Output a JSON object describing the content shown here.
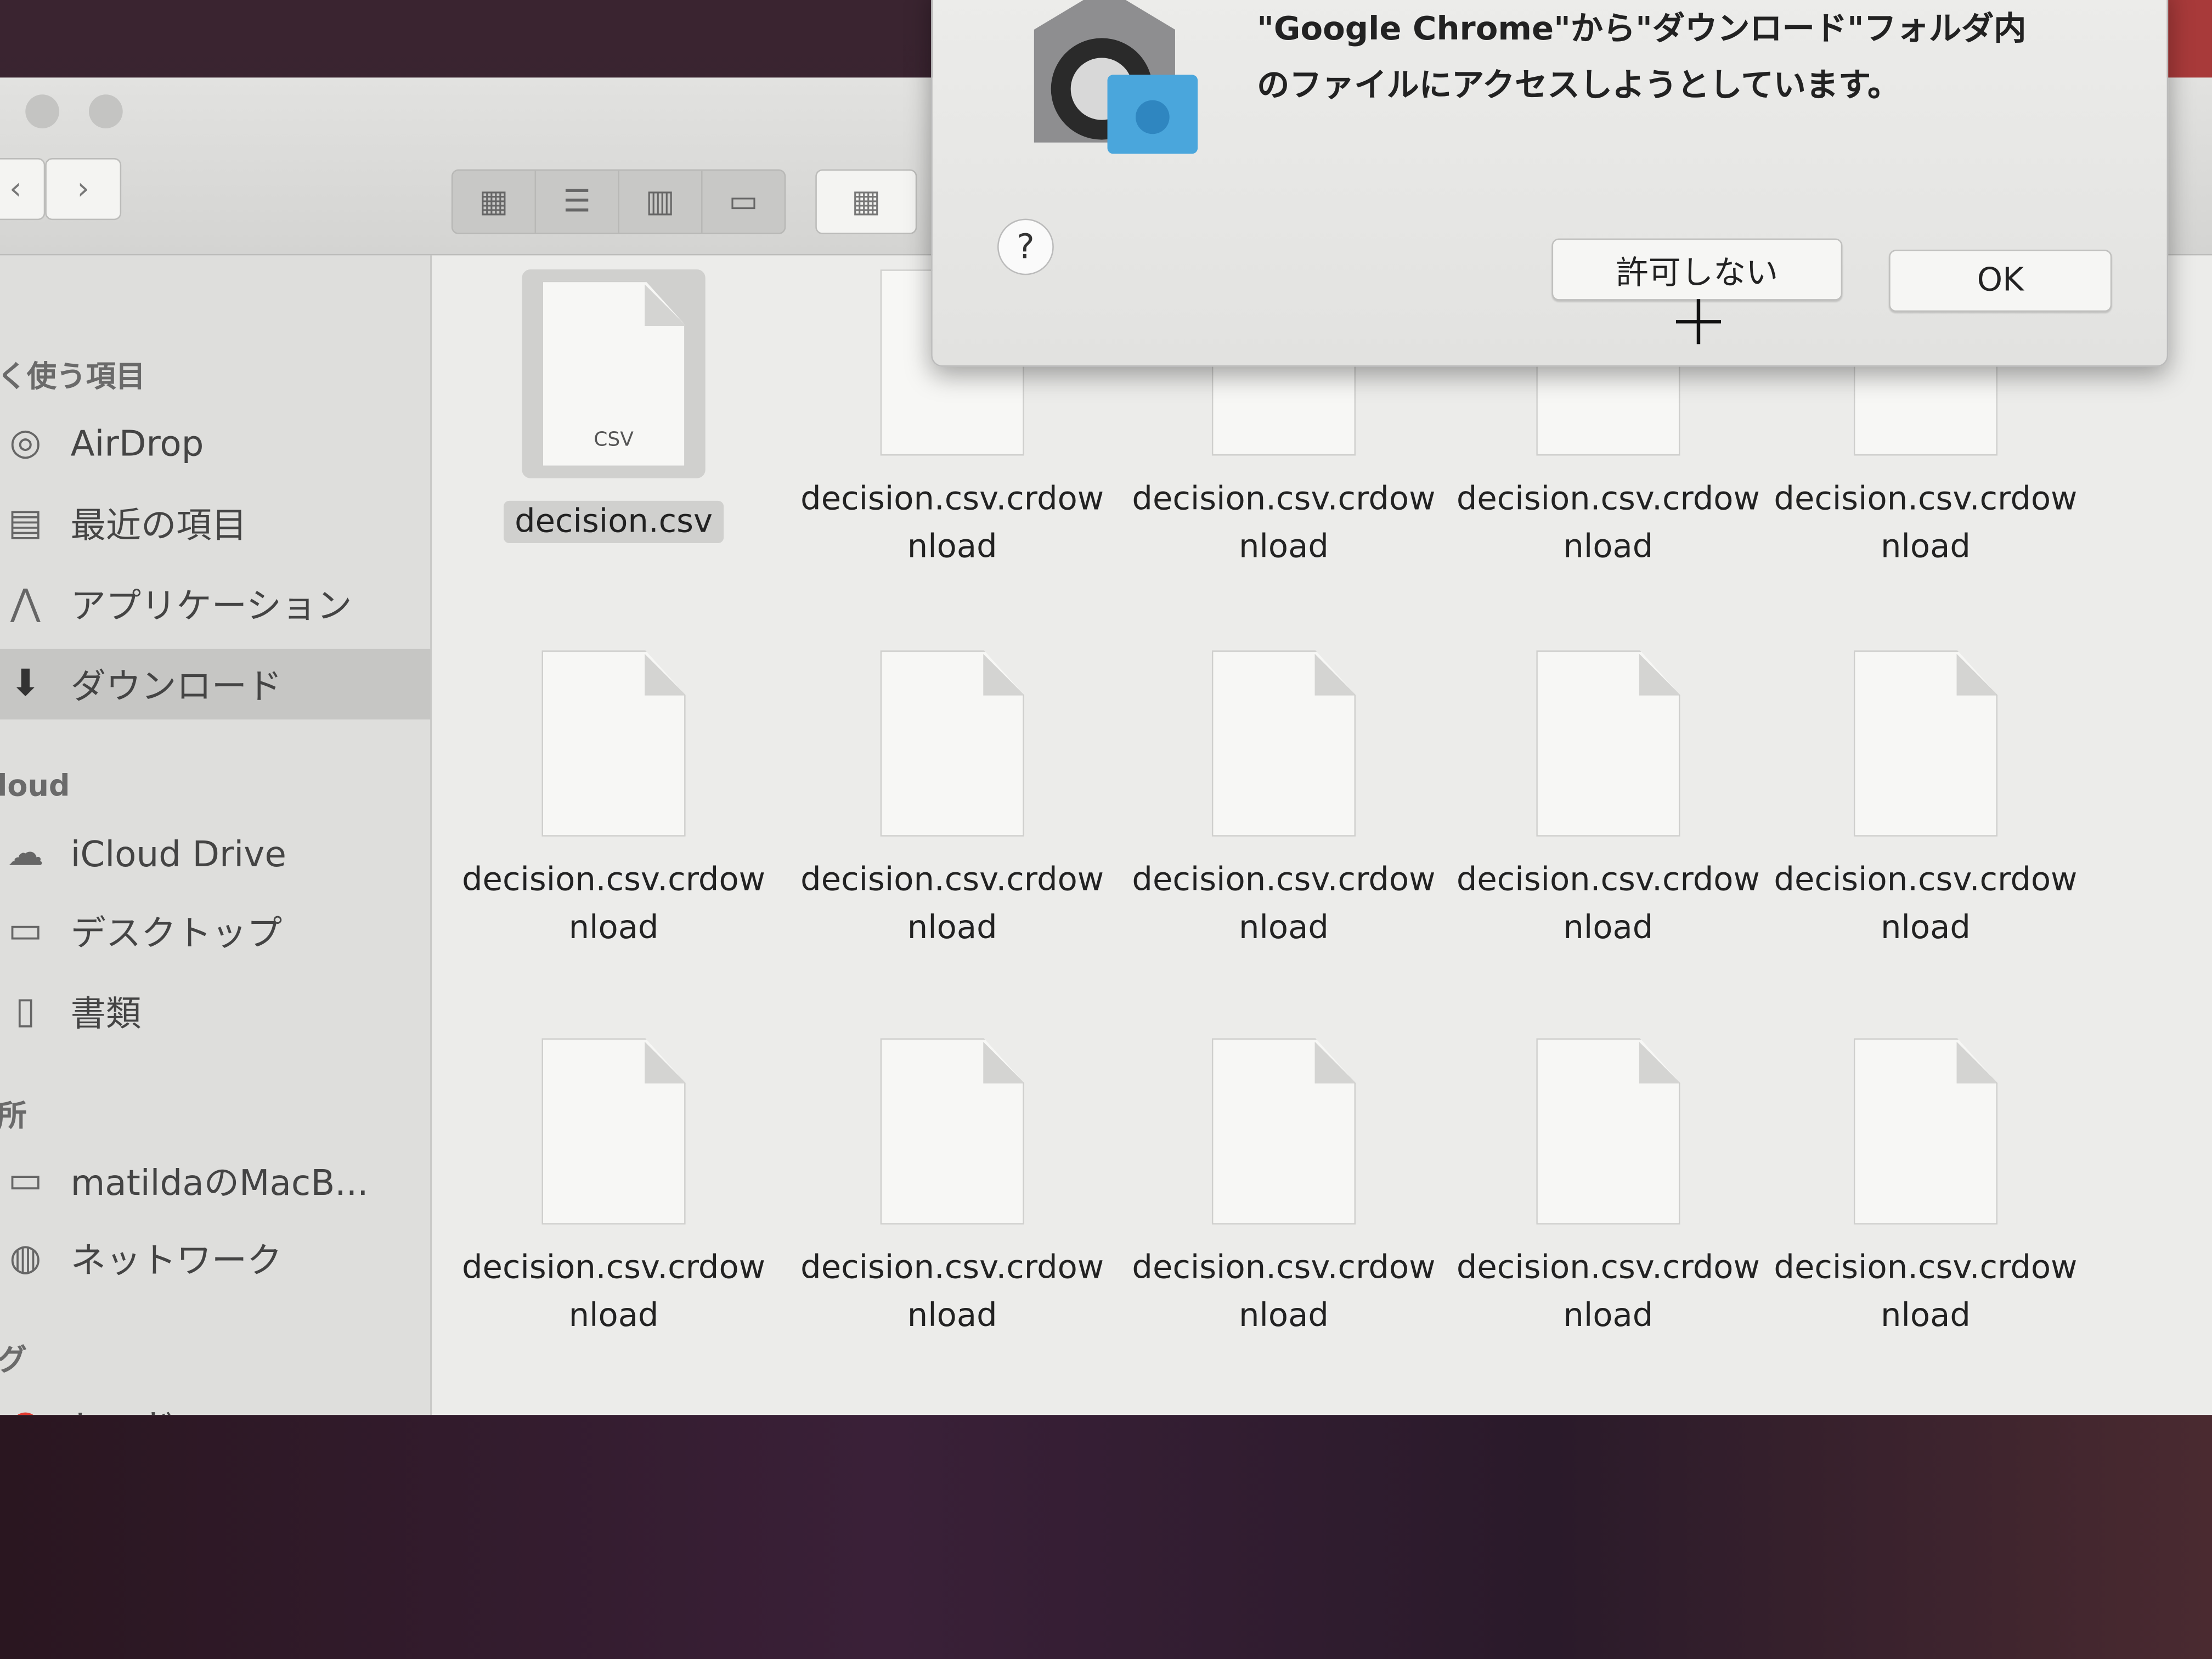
{
  "sidebar": {
    "sections": [
      {
        "header": "く使う項目",
        "items": [
          {
            "label": "AirDrop",
            "icon": "airdrop-icon"
          },
          {
            "label": "最近の項目",
            "icon": "recents-icon"
          },
          {
            "label": "アプリケーション",
            "icon": "applications-icon"
          },
          {
            "label": "ダウンロード",
            "icon": "downloads-icon",
            "selected": true
          }
        ]
      },
      {
        "header": "loud",
        "items": [
          {
            "label": "iCloud Drive",
            "icon": "cloud-icon"
          },
          {
            "label": "デスクトップ",
            "icon": "desktop-icon"
          },
          {
            "label": "書類",
            "icon": "documents-icon"
          }
        ]
      },
      {
        "header": "所",
        "items": [
          {
            "label": "matildaのMacB...",
            "icon": "laptop-icon"
          },
          {
            "label": "ネットワーク",
            "icon": "network-icon"
          }
        ]
      },
      {
        "header": "グ",
        "items": [
          {
            "label": "レッド",
            "icon": "tag-red-icon",
            "color": "#e03a30"
          }
        ]
      }
    ]
  },
  "files": [
    {
      "name": "decision.csv",
      "ext": "CSV",
      "selected": true
    },
    {
      "name": "decision.csv.crdownload"
    },
    {
      "name": "decision.csv.crdownload"
    },
    {
      "name": "decision.csv.crdownload"
    },
    {
      "name": "decision.csv.crdownload"
    },
    {
      "name": "decision.csv.crdownload"
    },
    {
      "name": "decision.csv.crdownload"
    },
    {
      "name": "decision.csv.crdownload"
    },
    {
      "name": "decision.csv.crdownload"
    },
    {
      "name": "decision.csv.crdownload"
    },
    {
      "name": "decision.csv.crdownload"
    },
    {
      "name": "decision.csv.crdownload"
    },
    {
      "name": "decision.csv.crdownload"
    },
    {
      "name": "decision.csv.crdownload"
    },
    {
      "name": "decision.csv.crdownload"
    }
  ],
  "dialog": {
    "line1": "\"Google Chrome\"から\"ダウンロード\"フォルダ内",
    "line2": "のファイルにアクセスしようとしています。",
    "help_label": "?",
    "deny_label": "許可しない",
    "ok_label": "OK"
  },
  "toolbar": {
    "back": "‹",
    "forward": "›"
  }
}
